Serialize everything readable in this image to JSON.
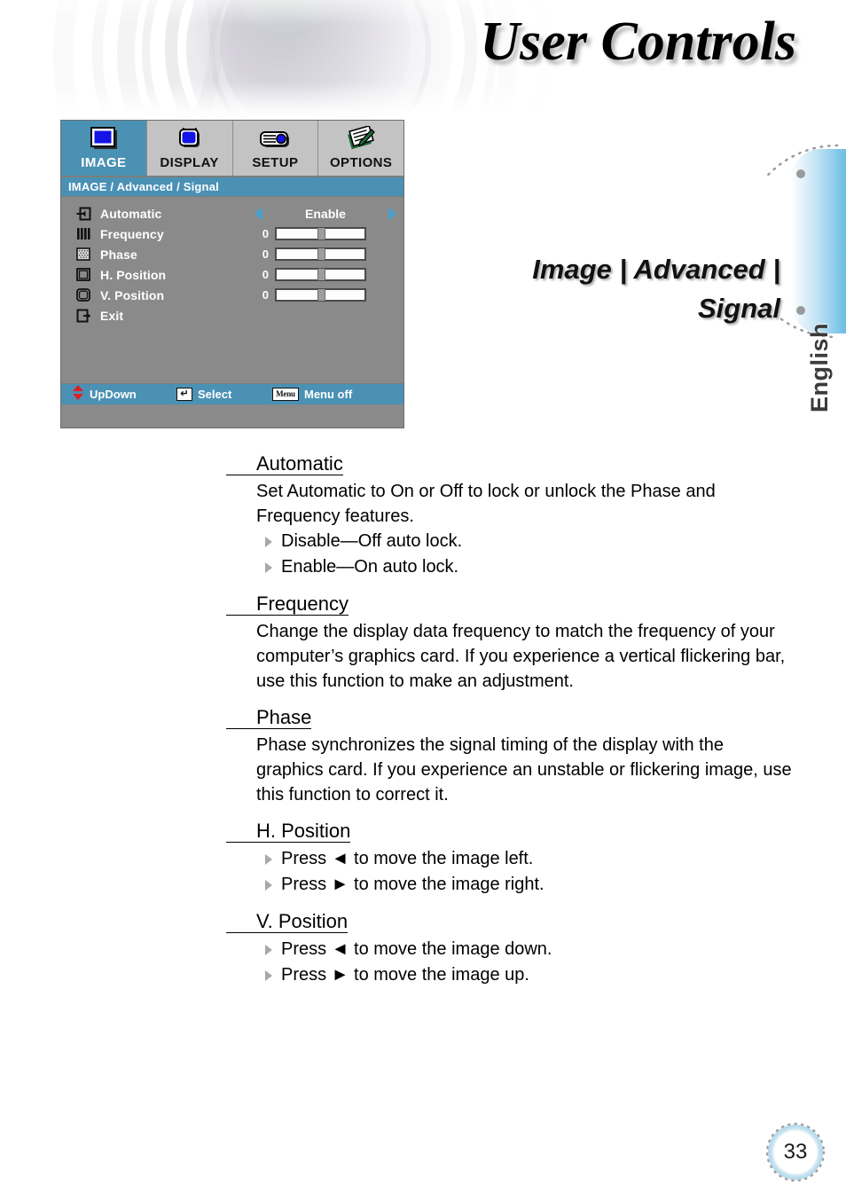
{
  "header": {
    "title_prefix": "U",
    "title": "User Controls",
    "graphic": "camera-lens-photo"
  },
  "language_tab": {
    "label": "English"
  },
  "osd": {
    "tabs": [
      {
        "label": "IMAGE",
        "icon": "monitor-icon",
        "active": true
      },
      {
        "label": "DISPLAY",
        "icon": "television-icon",
        "active": false
      },
      {
        "label": "SETUP",
        "icon": "projector-icon",
        "active": false
      },
      {
        "label": "OPTIONS",
        "icon": "clipboard-pencil-icon",
        "active": false
      }
    ],
    "title": "IMAGE / Advanced / Signal",
    "rows": [
      {
        "label": "Automatic",
        "icon": "arrow-into-box-icon",
        "type": "enum",
        "value": "Enable"
      },
      {
        "label": "Frequency",
        "icon": "vertical-bars-icon",
        "type": "slider",
        "value": "0"
      },
      {
        "label": "Phase",
        "icon": "dotted-square-icon",
        "type": "slider",
        "value": "0"
      },
      {
        "label": "H. Position",
        "icon": "square-outline-icon",
        "type": "slider",
        "value": "0"
      },
      {
        "label": "V. Position",
        "icon": "rounded-square-icon",
        "type": "slider",
        "value": "0"
      },
      {
        "label": "Exit",
        "icon": "arrow-out-of-box-icon",
        "type": "none",
        "value": ""
      }
    ],
    "footer": [
      {
        "label": "UpDown",
        "key": "updown-arrows-icon",
        "keytext": ""
      },
      {
        "label": "Select",
        "key": "enter-key-icon",
        "keytext": "↵"
      },
      {
        "label": "Menu off",
        "key": "menu-key-icon",
        "keytext": "Menu"
      }
    ],
    "colors": {
      "accent": "#4a91b4",
      "body": "#8a8a8a",
      "tab_inactive": "#c3c3c3",
      "arrow": "#4a9ec9",
      "updown_arrow": "#e01f26"
    }
  },
  "caption": {
    "line1": "Image | Advanced |",
    "line2": "Signal"
  },
  "sections": [
    {
      "heading": "Automatic",
      "paragraphs": [
        "Set Automatic to On or Off to lock or unlock the Phase and Frequency features."
      ],
      "bullets": [
        "Disable—Off auto lock.",
        "Enable—On auto lock."
      ]
    },
    {
      "heading": "Frequency",
      "paragraphs": [
        "Change the display data frequency to match the frequency of your computer’s graphics card. If you experience a vertical flickering bar, use this function to make an adjustment."
      ],
      "bullets": []
    },
    {
      "heading": "Phase",
      "paragraphs": [
        "Phase synchronizes the signal timing of the display with the graphics card. If you experience an unstable or flickering image, use this function to correct it."
      ],
      "bullets": []
    },
    {
      "heading": "H. Position",
      "paragraphs": [],
      "bullets": [
        "Press ◄ to move the image left.",
        "Press ► to move the image right."
      ]
    },
    {
      "heading": "V. Position",
      "paragraphs": [],
      "bullets": [
        "Press ◄ to move the image down.",
        "Press ► to move the image up."
      ]
    }
  ],
  "page_number": "33"
}
